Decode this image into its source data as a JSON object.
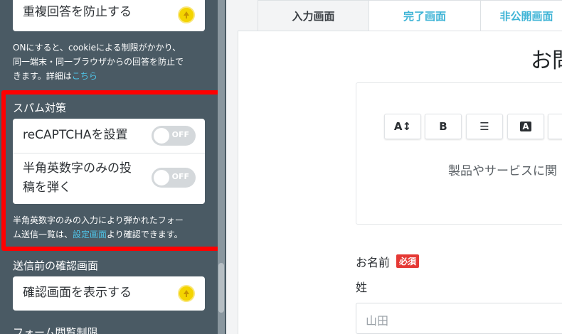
{
  "sidebar": {
    "duplicate_card_label": "重複回答を防止する",
    "duplicate_help_line1": "ONにすると、cookieによる制限がかかり、",
    "duplicate_help_line2": "同一端末・同一ブラウザからの回答を防止で",
    "duplicate_help_line3_prefix": "きます。詳細は",
    "duplicate_help_link": "こちら",
    "spam_title": "スパム対策",
    "recaptcha_label": "reCAPTCHAを設置",
    "recaptcha_toggle": "OFF",
    "alnum_label_line1": "半角英数字のみの投",
    "alnum_label_line2": "稿を弾く",
    "alnum_toggle": "OFF",
    "spam_help_line1": "半角英数字のみの入力により弾かれたフォー",
    "spam_help_line2_prefix": "ム送信一覧は、",
    "spam_help_link": "設定画面",
    "spam_help_line2_suffix": "より確認できます。",
    "confirm_title": "送信前の確認画面",
    "confirm_card_label": "確認画面を表示する",
    "view_limit_title": "フォーム閲覧制限"
  },
  "tabs": [
    {
      "label": "入力画面"
    },
    {
      "label": "完了画面"
    },
    {
      "label": "非公開画面"
    }
  ],
  "form": {
    "heading": "お問",
    "editor_placeholder": "製品やサービスに関",
    "name_label": "お名前",
    "required_badge": "必須",
    "last_name_label": "姓",
    "last_name_placeholder": "山田"
  },
  "toolbar_icons": [
    "text-size-icon",
    "bold-icon",
    "list-icon",
    "text-color-icon",
    "align-icon"
  ],
  "colors": {
    "sidebar_bg": "#4a5a64",
    "highlight": "#ff0000",
    "link": "#4fc3e6",
    "upgrade": "#f4d400",
    "required": "#e53935"
  }
}
